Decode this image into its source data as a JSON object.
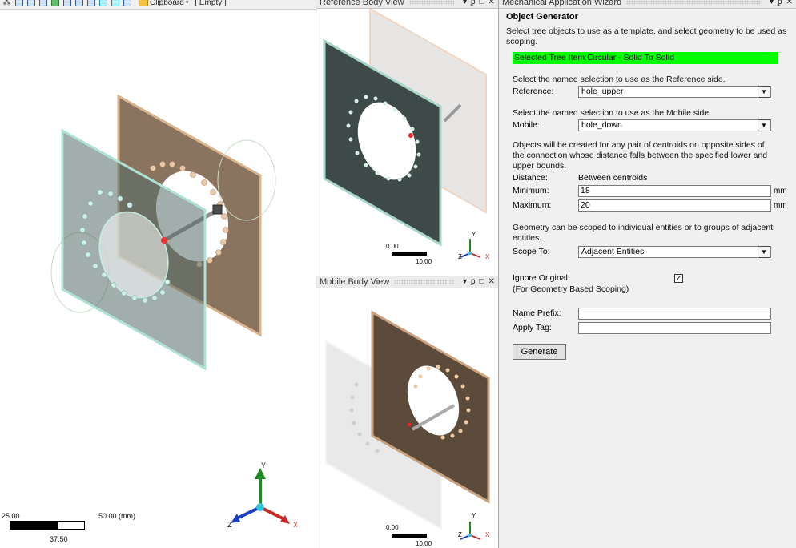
{
  "main_toolbar": {
    "clipboard_label": "Clipboard",
    "empty_label": "[ Empty ]"
  },
  "main_view": {
    "scale_left": "25.00",
    "scale_right": "50.00 (mm)",
    "scale_mid": "37.50",
    "triad": {
      "y": "Y",
      "z": "Z",
      "x": "X"
    }
  },
  "reference_pane": {
    "title": "Reference Body View",
    "scale_left": "0.00",
    "scale_right": "10.00",
    "triad": {
      "y": "Y",
      "z": "Z",
      "x": "X"
    }
  },
  "mobile_pane": {
    "title": "Mobile Body View",
    "scale_left": "0.00",
    "scale_right": "10.00",
    "triad": {
      "y": "Y",
      "z": "Z",
      "x": "X"
    }
  },
  "wizard": {
    "title": "Mechanical Application Wizard",
    "heading": "Object Generator",
    "intro": "Select tree objects to use as a template, and select geometry to be used as scoping.",
    "selected_item": "Selected Tree Item:Circular - Solid To Solid",
    "reference_instruction": "Select the named selection to use as the Reference side.",
    "reference_label": "Reference:",
    "reference_value": "hole_upper",
    "mobile_instruction": "Select the named selection to use as the Mobile side.",
    "mobile_label": "Mobile:",
    "mobile_value": "hole_down",
    "objects_info": "Objects will be created for any pair of centroids on opposite sides of the connection whose distance falls between the specified lower and upper bounds.",
    "distance_label": "Distance:",
    "distance_value": "Between centroids",
    "minimum_label": "Minimum:",
    "minimum_value": "18",
    "maximum_label": "Maximum:",
    "maximum_value": "20",
    "unit": "mm",
    "scope_info": "Geometry can be scoped to individual entities or to groups of adjacent entities.",
    "scope_label": "Scope To:",
    "scope_value": "Adjacent Entities",
    "ignore_label": "Ignore Original:",
    "ignore_checked": "✓",
    "ignore_note": "(For Geometry Based Scoping)",
    "name_prefix_label": "Name Prefix:",
    "name_prefix_value": "",
    "apply_tag_label": "Apply Tag:",
    "apply_tag_value": "",
    "generate_label": "Generate"
  },
  "pane_controls": {
    "dropdown": "▾",
    "pin": "ᵱ",
    "restore": "□",
    "close": "✕"
  }
}
